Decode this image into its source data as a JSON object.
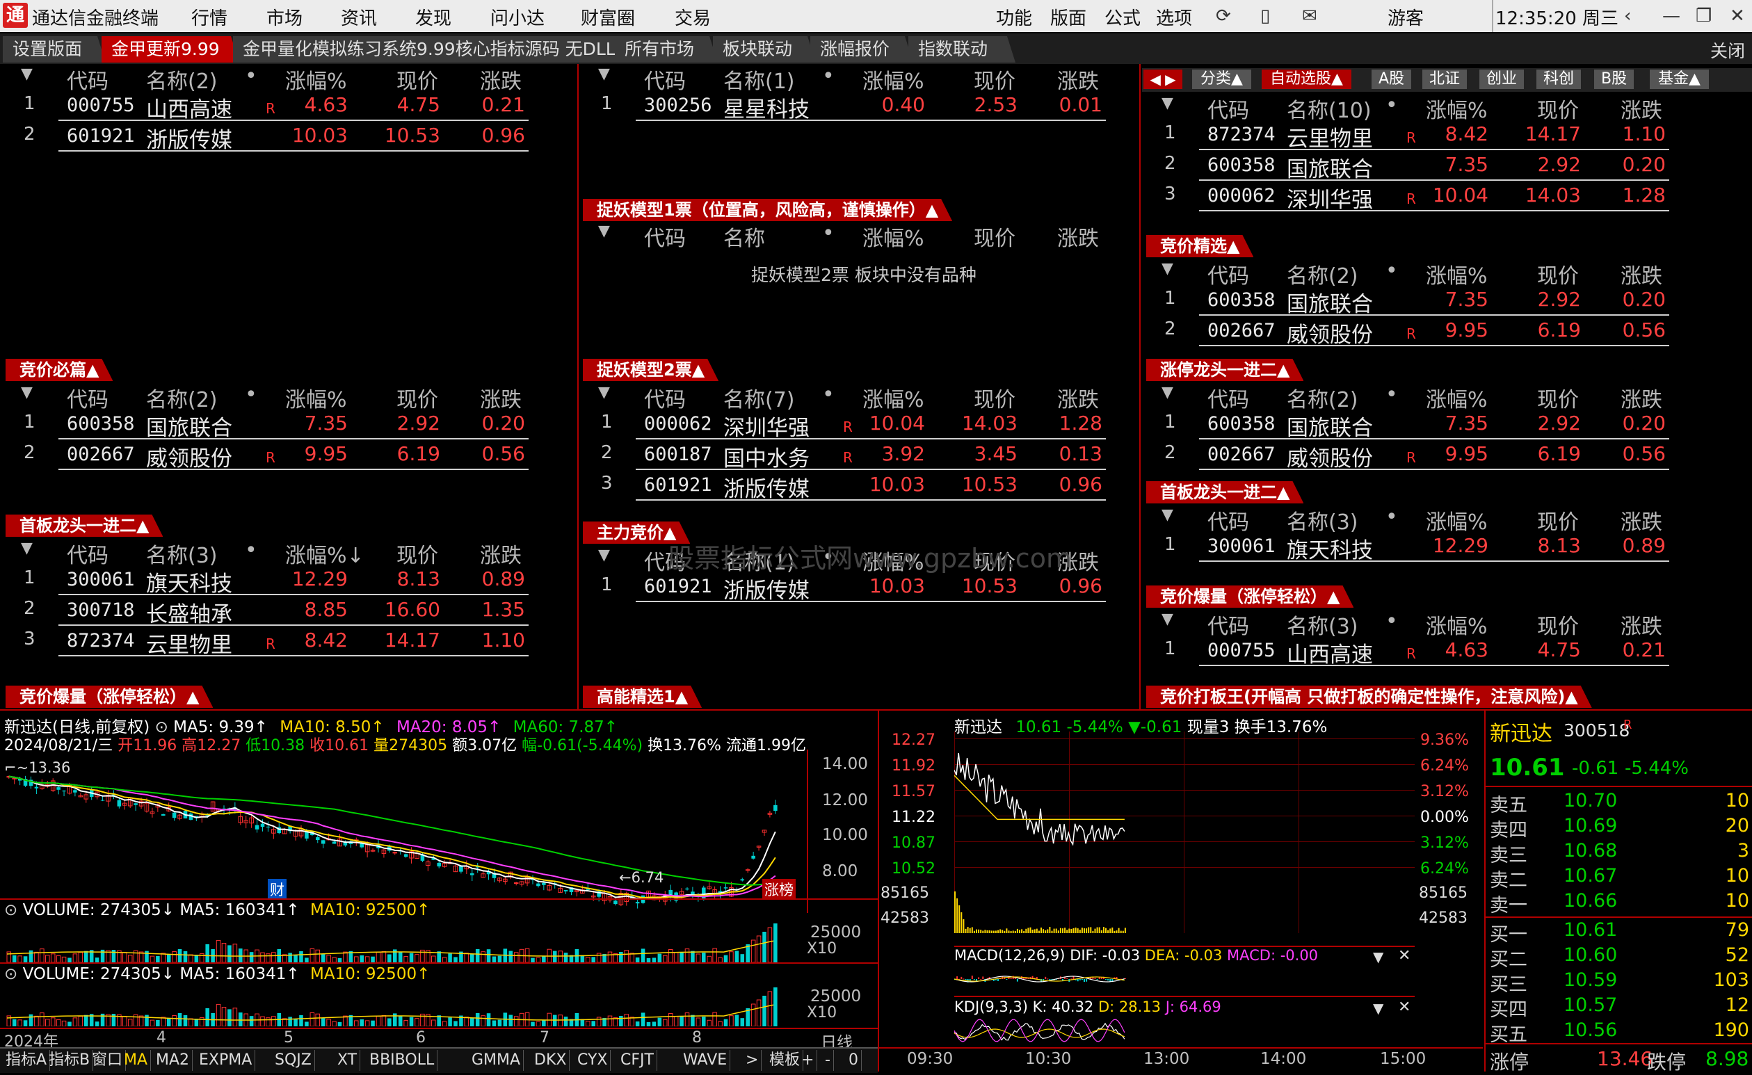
{
  "app": {
    "title": "通达信金融终端",
    "logo_glyph": "通"
  },
  "menu": [
    "行情",
    "市场",
    "资讯",
    "发现",
    "问小达",
    "财富圈",
    "交易"
  ],
  "toolbar": [
    "功能",
    "版面",
    "公式",
    "选项"
  ],
  "user": "游客",
  "clock": "12:35:20 周三",
  "tabs": [
    "设置版面",
    "金甲更新9.99",
    "金甲量化模拟练习系统9.99核心指标源码 无DLL",
    "所有市场",
    "板块联动",
    "涨幅报价",
    "指数联动"
  ],
  "close_label": "关闭",
  "headers": {
    "code": "代码",
    "name": "名称",
    "pct": "涨幅%",
    "price": "现价",
    "chg": "涨跌"
  },
  "mid_tabs": [
    "分类▲",
    "自动选股▲",
    "A股",
    "北证",
    "创业",
    "科创",
    "B股",
    "基金▲"
  ],
  "panels": {
    "p1": {
      "name_hdr": "名称(2)",
      "rows": [
        {
          "i": "1",
          "code": "000755",
          "name": "山西高速",
          "r": "R",
          "pct": "4.63",
          "price": "4.75",
          "chg": "0.21"
        },
        {
          "i": "2",
          "code": "601921",
          "name": "浙版传媒",
          "r": "",
          "pct": "10.03",
          "price": "10.53",
          "chg": "0.96"
        }
      ]
    },
    "p2": {
      "name_hdr": "名称(1)",
      "rows": [
        {
          "i": "1",
          "code": "300256",
          "name": "星星科技",
          "r": "",
          "pct": "0.40",
          "price": "2.53",
          "chg": "0.01"
        }
      ]
    },
    "p3": {
      "title": "捉妖模型1票（位置高，风险高，谨慎操作）▲",
      "name_hdr": "名称",
      "empty": "捉妖模型2票 板块中没有品种"
    },
    "p4": {
      "name_hdr": "名称(10)",
      "rows": [
        {
          "i": "1",
          "code": "872374",
          "name": "云里物里",
          "r": "R",
          "pct": "8.42",
          "price": "14.17",
          "chg": "1.10"
        },
        {
          "i": "2",
          "code": "600358",
          "name": "国旅联合",
          "r": "",
          "pct": "7.35",
          "price": "2.92",
          "chg": "0.20"
        },
        {
          "i": "3",
          "code": "000062",
          "name": "深圳华强",
          "r": "R",
          "pct": "10.04",
          "price": "14.03",
          "chg": "1.28"
        }
      ]
    },
    "p5": {
      "title": "竞价精选▲",
      "name_hdr": "名称(2)",
      "rows": [
        {
          "i": "1",
          "code": "600358",
          "name": "国旅联合",
          "r": "",
          "pct": "7.35",
          "price": "2.92",
          "chg": "0.20"
        },
        {
          "i": "2",
          "code": "002667",
          "name": "威领股份",
          "r": "R",
          "pct": "9.95",
          "price": "6.19",
          "chg": "0.56"
        }
      ]
    },
    "p6": {
      "title": "竞价必篇▲",
      "name_hdr": "名称(2)",
      "rows": [
        {
          "i": "1",
          "code": "600358",
          "name": "国旅联合",
          "r": "",
          "pct": "7.35",
          "price": "2.92",
          "chg": "0.20"
        },
        {
          "i": "2",
          "code": "002667",
          "name": "威领股份",
          "r": "R",
          "pct": "9.95",
          "price": "6.19",
          "chg": "0.56"
        }
      ]
    },
    "p7": {
      "title": "捉妖模型2票▲",
      "name_hdr": "名称(7)",
      "rows": [
        {
          "i": "1",
          "code": "000062",
          "name": "深圳华强",
          "r": "R",
          "pct": "10.04",
          "price": "14.03",
          "chg": "1.28"
        },
        {
          "i": "2",
          "code": "600187",
          "name": "国中水务",
          "r": "R",
          "pct": "3.92",
          "price": "3.45",
          "chg": "0.13"
        },
        {
          "i": "3",
          "code": "601921",
          "name": "浙版传媒",
          "r": "",
          "pct": "10.03",
          "price": "10.53",
          "chg": "0.96"
        }
      ]
    },
    "p8": {
      "title": "涨停龙头一进二▲",
      "name_hdr": "名称(2)",
      "rows": [
        {
          "i": "1",
          "code": "600358",
          "name": "国旅联合",
          "r": "",
          "pct": "7.35",
          "price": "2.92",
          "chg": "0.20"
        },
        {
          "i": "2",
          "code": "002667",
          "name": "威领股份",
          "r": "R",
          "pct": "9.95",
          "price": "6.19",
          "chg": "0.56"
        }
      ]
    },
    "p9": {
      "title": "首板龙头一进二▲",
      "name_hdr": "名称(3)",
      "pct_hdr": "涨幅%↓",
      "rows": [
        {
          "i": "1",
          "code": "300061",
          "name": "旗天科技",
          "r": "",
          "pct": "12.29",
          "price": "8.13",
          "chg": "0.89"
        },
        {
          "i": "2",
          "code": "300718",
          "name": "长盛轴承",
          "r": "",
          "pct": "8.85",
          "price": "16.60",
          "chg": "1.35"
        },
        {
          "i": "3",
          "code": "872374",
          "name": "云里物里",
          "r": "R",
          "pct": "8.42",
          "price": "14.17",
          "chg": "1.10"
        }
      ]
    },
    "p10": {
      "title": "主力竞价▲",
      "name_hdr": "名称(1)",
      "rows": [
        {
          "i": "1",
          "code": "601921",
          "name": "浙版传媒",
          "r": "",
          "pct": "10.03",
          "price": "10.53",
          "chg": "0.96"
        }
      ]
    },
    "p11": {
      "title": "首板龙头一进二▲",
      "name_hdr": "名称(3)",
      "rows": [
        {
          "i": "1",
          "code": "300061",
          "name": "旗天科技",
          "r": "",
          "pct": "12.29",
          "price": "8.13",
          "chg": "0.89"
        }
      ]
    },
    "p12": {
      "title": "竞价爆量（涨停轻松）▲",
      "name_hdr": "名称(3)",
      "rows": [
        {
          "i": "1",
          "code": "000755",
          "name": "山西高速",
          "r": "R",
          "pct": "4.63",
          "price": "4.75",
          "chg": "0.21"
        }
      ]
    },
    "bottom_titles": {
      "left": "竞价爆量（涨停轻松）▲",
      "mid": "高能精选1▲",
      "right": "竞价打板王(开幅高 只做打板的确定性操作，注意风险)▲"
    }
  },
  "watermark": "股票指标公式网www.gpzbw.com",
  "kline": {
    "title": "新迅达(日线,前复权)",
    "ma_labels": {
      "ma5": "MA5: 9.39↑",
      "ma10": "MA10: 8.50↑",
      "ma20": "MA20: 8.05↑",
      "ma60": "MA60: 7.87↑"
    },
    "info_date": "2024/08/21/三",
    "info_open": "开11.96",
    "info_high": "高12.27",
    "info_low": "低10.38",
    "info_close": "收10.61",
    "info_vol": "量274305",
    "info_amt": "额3.07亿",
    "info_chg": "幅-0.61(-5.44%)",
    "info_turn": "换13.76%",
    "info_float": "流通1.99亿",
    "high_mark": "13.36",
    "low_mark": "6.74",
    "cai_label": "财",
    "zb_label": "涨榜",
    "yaxis": [
      "14.00",
      "12.00",
      "10.00",
      "8.00"
    ],
    "vol1": {
      "label": "VOLUME: 274305↓",
      "ma5": "MA5: 160341↑",
      "ma10": "MA10: 92500↑",
      "tick": "25000",
      "unit": "X10"
    },
    "vol2": {
      "label": "VOLUME: 274305↓",
      "ma5": "MA5: 160341↑",
      "ma10": "MA10: 92500↑",
      "tick": "25000",
      "unit": "X10"
    },
    "xaxis": [
      "2024年",
      "4",
      "5",
      "6",
      "7",
      "8"
    ],
    "period": "日线"
  },
  "bottom_tabs": [
    "指标A",
    "指标B",
    "窗口",
    "MA",
    "MA2",
    "EXPMA",
    "SQJZ",
    "XT",
    "BBIBOLL",
    "GMMA",
    "DKX",
    "CYX",
    "CFJT",
    "WAVE",
    ">",
    "模板",
    "+",
    "-",
    "0"
  ],
  "intraday": {
    "name": "新迅达",
    "price": "10.61",
    "pct": "-5.44%",
    "chg": "▼-0.61",
    "vol": "现量3",
    "turn": "换手13.76%",
    "left_ticks": [
      "12.27",
      "11.92",
      "11.57",
      "11.22",
      "10.87",
      "10.52"
    ],
    "right_ticks": [
      "9.36%",
      "6.24%",
      "3.12%",
      "0.00%",
      "3.12%",
      "6.24%"
    ],
    "vol_ticks": [
      "85165",
      "42583"
    ],
    "macd": {
      "label": "MACD(12,26,9)",
      "dif": "DIF: -0.03",
      "dea": "DEA: -0.03",
      "macd": "MACD: -0.00"
    },
    "kdj": {
      "label": "KDJ(9,3,3)",
      "k": "K: 40.32",
      "d": "D: 28.13",
      "j": "J: 64.69"
    },
    "times": [
      "09:30",
      "10:30",
      "13:00",
      "14:00",
      "15:00"
    ]
  },
  "quote": {
    "name": "新迅达",
    "code": "300518",
    "r": "R",
    "price": "10.61",
    "chg": "-0.61",
    "pct": "-5.44%",
    "asks": [
      {
        "label": "卖五",
        "price": "10.70",
        "vol": "10"
      },
      {
        "label": "卖四",
        "price": "10.69",
        "vol": "20"
      },
      {
        "label": "卖三",
        "price": "10.68",
        "vol": "3"
      },
      {
        "label": "卖二",
        "price": "10.67",
        "vol": "10"
      },
      {
        "label": "卖一",
        "price": "10.66",
        "vol": "10"
      }
    ],
    "bids": [
      {
        "label": "买一",
        "price": "10.61",
        "vol": "79"
      },
      {
        "label": "买二",
        "price": "10.60",
        "vol": "52"
      },
      {
        "label": "买三",
        "price": "10.59",
        "vol": "103"
      },
      {
        "label": "买四",
        "price": "10.57",
        "vol": "12"
      },
      {
        "label": "买五",
        "price": "10.56",
        "vol": "190"
      }
    ],
    "limit_up_label": "涨停",
    "limit_up": "13.46",
    "limit_down_label": "跌停",
    "limit_down": "8.98"
  }
}
